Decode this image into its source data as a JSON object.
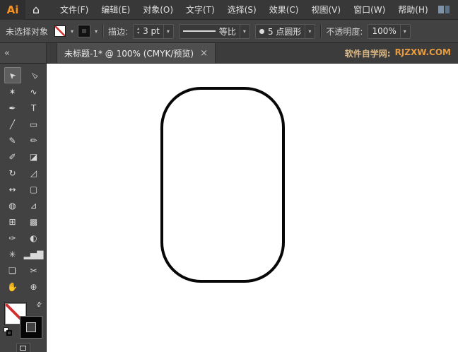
{
  "menubar": {
    "logo": "Ai",
    "items": [
      {
        "id": "file",
        "label": "文件(F)"
      },
      {
        "id": "edit",
        "label": "编辑(E)"
      },
      {
        "id": "object",
        "label": "对象(O)"
      },
      {
        "id": "type",
        "label": "文字(T)"
      },
      {
        "id": "select",
        "label": "选择(S)"
      },
      {
        "id": "effect",
        "label": "效果(C)"
      },
      {
        "id": "view",
        "label": "视图(V)"
      },
      {
        "id": "window",
        "label": "窗口(W)"
      },
      {
        "id": "help",
        "label": "帮助(H)"
      }
    ]
  },
  "controlbar": {
    "status": "未选择对象",
    "stroke_label": "描边:",
    "stroke_value": "3 pt",
    "width_profile": "等比",
    "brush": "5 点圆形",
    "opacity_label": "不透明度:",
    "opacity_value": "100%"
  },
  "tabrow": {
    "collapse": "«",
    "tab_title": "未标题-1* @ 100% (CMYK/预览)",
    "tab_close": "×",
    "site_label": "软件自学网:",
    "site_url": "RJZXW.COM"
  },
  "icons": {
    "home": "⌂",
    "dropdown": "▾",
    "stepper_up": "▴",
    "stepper_down": "▾",
    "swap": "⇄"
  },
  "toolbar": {
    "tools": [
      {
        "name": "selection-tool",
        "glyph": "➤",
        "rotate": -135,
        "active": true
      },
      {
        "name": "direct-selection-tool",
        "glyph": "▻",
        "rotate": -135
      },
      {
        "name": "magic-wand-tool",
        "glyph": "✶"
      },
      {
        "name": "lasso-tool",
        "glyph": "∿"
      },
      {
        "name": "pen-tool",
        "glyph": "✒"
      },
      {
        "name": "type-tool",
        "glyph": "T"
      },
      {
        "name": "line-segment-tool",
        "glyph": "╱"
      },
      {
        "name": "rectangle-tool",
        "glyph": "▭"
      },
      {
        "name": "paintbrush-tool",
        "glyph": "✎"
      },
      {
        "name": "pencil-tool",
        "glyph": "✏"
      },
      {
        "name": "blob-brush-tool",
        "glyph": "✐"
      },
      {
        "name": "eraser-tool",
        "glyph": "◪"
      },
      {
        "name": "rotate-tool",
        "glyph": "↻"
      },
      {
        "name": "scale-tool",
        "glyph": "◿"
      },
      {
        "name": "width-tool",
        "glyph": "↭"
      },
      {
        "name": "free-transform-tool",
        "glyph": "▢"
      },
      {
        "name": "shape-builder-tool",
        "glyph": "◍"
      },
      {
        "name": "perspective-grid-tool",
        "glyph": "⊿"
      },
      {
        "name": "mesh-tool",
        "glyph": "⊞"
      },
      {
        "name": "gradient-tool",
        "glyph": "▩"
      },
      {
        "name": "eyedropper-tool",
        "glyph": "✑"
      },
      {
        "name": "blend-tool",
        "glyph": "◐"
      },
      {
        "name": "symbol-sprayer-tool",
        "glyph": "✳"
      },
      {
        "name": "column-graph-tool",
        "glyph": "▂▅▇"
      },
      {
        "name": "artboard-tool",
        "glyph": "❏"
      },
      {
        "name": "slice-tool",
        "glyph": "✂"
      },
      {
        "name": "hand-tool",
        "glyph": "✋"
      },
      {
        "name": "zoom-tool",
        "glyph": "⊕"
      }
    ]
  },
  "swatches": {
    "fill": "none",
    "stroke": "#000000"
  },
  "canvas": {
    "zoom": "100%",
    "color_mode": "CMYK",
    "shape": {
      "type": "rounded-rectangle",
      "fill": "#ffffff",
      "stroke": "#000000",
      "stroke_width": "3 pt"
    }
  },
  "colors": {
    "accent_orange": "#f7941d",
    "site_orange": "#e89b3c",
    "panel_bg": "#424242",
    "canvas_bg": "#ffffff"
  }
}
